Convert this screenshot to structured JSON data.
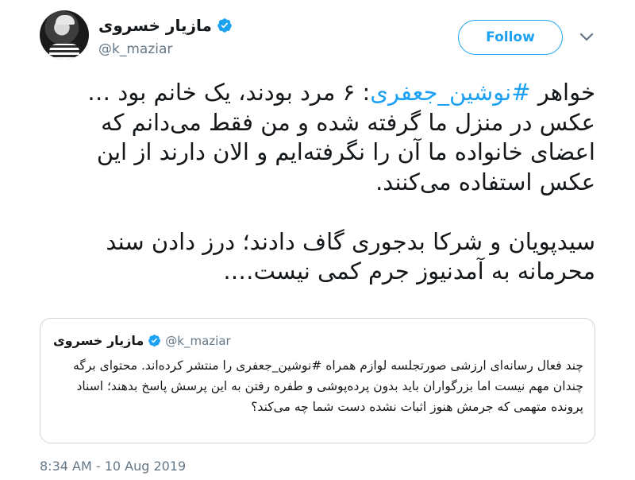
{
  "author": {
    "display_name": "مازیار خسروی",
    "handle": "@k_maziar"
  },
  "follow_button": {
    "label": "Follow"
  },
  "tweet": {
    "paragraph1_pre": "خواهر ",
    "paragraph1_hashtag": "#نوشین_جعفری",
    "paragraph1_post": ": ۶ مرد بودند، یک خانم بود …عکس در منزل ما گرفته شده و من فقط می‌دانم که اعضای خانواده ما آن را نگرفته‌ایم و الان دارند از این عکس استفاده می‌کنند.",
    "paragraph2": "سیدپویان و شرکا بدجوری گاف دادند؛ درز دادن سند محرمانه به آمدنیوز جرم کمی نیست…."
  },
  "quoted_tweet": {
    "display_name": "مازیار خسروی",
    "handle": "@k_maziar",
    "text": "چند فعال رسانه‌ای ارزشی صورتجلسه لوازم همراه #نوشین_جعفری را منتشر کرده‌اند. محتوای برگه چندان مهم نیست اما بزرگواران باید بدون پرده‌پوشی و طفره رفتن به این پرسش پاسخ بدهند؛ اسناد پرونده متهمی که جرمش هنوز اثبات نشده دست شما چه می‌کند؟"
  },
  "timestamp": "8:34 AM - 10 Aug 2019",
  "colors": {
    "accent": "#1da1f2",
    "text": "#14171a",
    "secondary": "#657786",
    "border": "#ccd6dd"
  },
  "icons": {
    "verified": "verified-badge-icon",
    "menu": "chevron-down-icon"
  }
}
